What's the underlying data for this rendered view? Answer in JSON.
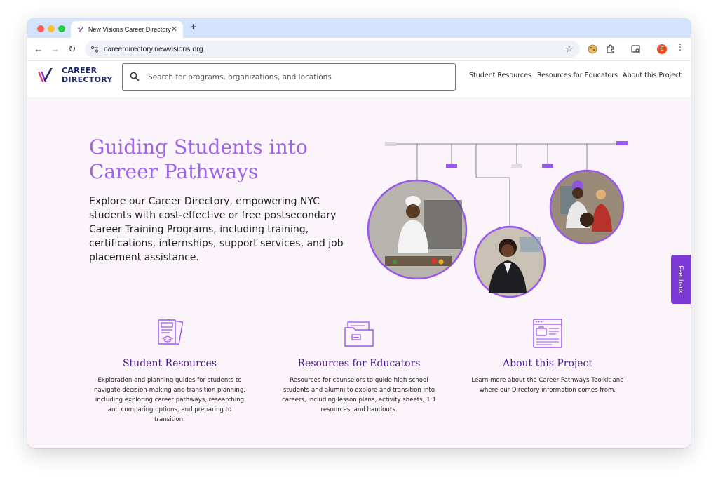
{
  "browser": {
    "tab_title": "New Visions Career Directory",
    "url": "careerdirectory.newvisions.org",
    "profile_initial": "E"
  },
  "header": {
    "logo_line1": "CAREER",
    "logo_line2": "DIRECTORY",
    "search_placeholder": "Search for programs, organizations, and locations",
    "nav": [
      "Student Resources",
      "Resources for Educators",
      "About this Project"
    ]
  },
  "hero": {
    "title_line1": "Guiding Students into",
    "title_line2": "Career Pathways",
    "body": "Explore our Career Directory, empowering NYC students with cost-effective or free postsecondary Career Training Programs, including training, certifications, internships, support services, and job placement assistance."
  },
  "feedback_label": "Feedback",
  "cards": [
    {
      "title": "Student Resources",
      "description": "Exploration and planning guides for students to navigate decision-making and transition planning, including exploring career pathways, researching and comparing options, and preparing to transition.",
      "icon": "documents-graduation-icon"
    },
    {
      "title": "Resources for Educators",
      "description": "Resources for counselors to guide high school students and alumni to explore and transition into careers, including lesson plans, activity sheets, 1:1 resources, and handouts.",
      "icon": "folder-icon"
    },
    {
      "title": "About this Project",
      "description": "Learn more about the Career Pathways Toolkit and where our Directory information comes from.",
      "icon": "browser-briefcase-icon"
    }
  ],
  "colors": {
    "brand_purple": "#7c39d6",
    "hero_title": "#a065e6",
    "card_title": "#4a158f",
    "logo_navy": "#1e2a6b",
    "page_bg": "#fbf4fb"
  }
}
